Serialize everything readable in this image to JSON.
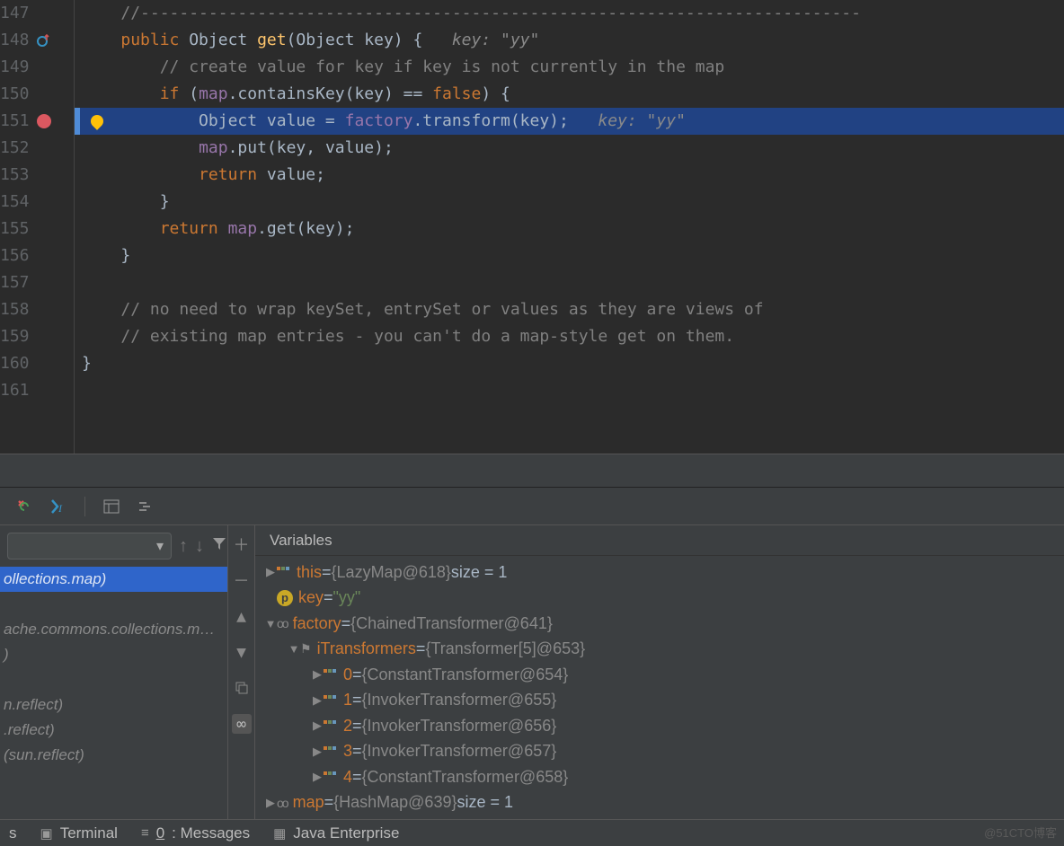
{
  "code": {
    "lines": [
      {
        "num": "147",
        "tokens": [
          {
            "c": "comment",
            "t": "//--------------------------------------------------------------------------"
          }
        ],
        "sep": true
      },
      {
        "num": "148",
        "tokens": [
          {
            "c": "kw",
            "t": "public "
          },
          {
            "c": "plain",
            "t": "Object "
          },
          {
            "c": "method-decl",
            "t": "get"
          },
          {
            "c": "plain",
            "t": "(Object key) {   "
          },
          {
            "c": "inlay",
            "t": "key: \"yy\""
          }
        ],
        "icon": "override"
      },
      {
        "num": "149",
        "tokens": [
          {
            "c": "comment",
            "t": "    // create value for key if key is not currently in the map"
          }
        ]
      },
      {
        "num": "150",
        "tokens": [
          {
            "c": "kw",
            "t": "    if "
          },
          {
            "c": "plain",
            "t": "("
          },
          {
            "c": "field",
            "t": "map"
          },
          {
            "c": "plain",
            "t": ".containsKey(key) == "
          },
          {
            "c": "kw",
            "t": "false"
          },
          {
            "c": "plain",
            "t": ") {"
          }
        ]
      },
      {
        "num": "151",
        "tokens": [
          {
            "c": "plain",
            "t": "        Object value = "
          },
          {
            "c": "field",
            "t": "factory"
          },
          {
            "c": "plain",
            "t": ".transform(key);   "
          },
          {
            "c": "inlay",
            "t": "key: \"yy\""
          }
        ],
        "hl": true,
        "bp": true,
        "bulb": true
      },
      {
        "num": "152",
        "tokens": [
          {
            "c": "plain",
            "t": "        "
          },
          {
            "c": "field",
            "t": "map"
          },
          {
            "c": "plain",
            "t": ".put(key, value);"
          }
        ]
      },
      {
        "num": "153",
        "tokens": [
          {
            "c": "kw",
            "t": "        return "
          },
          {
            "c": "plain",
            "t": "value;"
          }
        ]
      },
      {
        "num": "154",
        "tokens": [
          {
            "c": "plain",
            "t": "    }"
          }
        ]
      },
      {
        "num": "155",
        "tokens": [
          {
            "c": "kw",
            "t": "    return "
          },
          {
            "c": "field",
            "t": "map"
          },
          {
            "c": "plain",
            "t": ".get(key);"
          }
        ]
      },
      {
        "num": "156",
        "tokens": [
          {
            "c": "plain",
            "t": "}"
          }
        ]
      },
      {
        "num": "157",
        "tokens": [
          {
            "c": "plain",
            "t": ""
          }
        ]
      },
      {
        "num": "158",
        "tokens": [
          {
            "c": "comment",
            "t": "// no need to wrap keySet, entrySet or values as they are views of"
          }
        ]
      },
      {
        "num": "159",
        "tokens": [
          {
            "c": "comment",
            "t": "// existing map entries - you can't do a map-style get on them."
          }
        ]
      },
      {
        "num": "160",
        "tokens": [
          {
            "c": "plain",
            "t": "}"
          }
        ],
        "dedent": true
      },
      {
        "num": "161",
        "tokens": [
          {
            "c": "plain",
            "t": ""
          }
        ]
      }
    ],
    "base_indent": "    "
  },
  "frames": [
    {
      "text": "ollections.map)",
      "selected": true
    },
    {
      "text": ""
    },
    {
      "text": "ache.commons.collections.m…",
      "i": true
    },
    {
      "text": ")",
      "i": true
    },
    {
      "text": ""
    },
    {
      "text": "n.reflect)",
      "i": true
    },
    {
      "text": ".reflect)",
      "i": true
    },
    {
      "text": " (sun.reflect)",
      "i": true
    }
  ],
  "vars_title": "Variables",
  "vars": [
    {
      "indent": 0,
      "exp": "▶",
      "icon": "obj",
      "name": "this",
      "eq": " = ",
      "obj": "{LazyMap@618}",
      "size": "  size = 1"
    },
    {
      "indent": 0,
      "exp": "",
      "icon": "p",
      "name": "key",
      "eq": " = ",
      "str": "\"yy\""
    },
    {
      "indent": 0,
      "exp": "▼",
      "icon": "inf",
      "name": "factory",
      "eq": " = ",
      "obj": "{ChainedTransformer@641}"
    },
    {
      "indent": 1,
      "exp": "▼",
      "icon": "flag",
      "name": "iTransformers",
      "eq": " = ",
      "obj": "{Transformer[5]@653}"
    },
    {
      "indent": 2,
      "exp": "▶",
      "icon": "obj",
      "name": "0",
      "eq": " = ",
      "obj": "{ConstantTransformer@654}"
    },
    {
      "indent": 2,
      "exp": "▶",
      "icon": "obj",
      "name": "1",
      "eq": " = ",
      "obj": "{InvokerTransformer@655}"
    },
    {
      "indent": 2,
      "exp": "▶",
      "icon": "obj",
      "name": "2",
      "eq": " = ",
      "obj": "{InvokerTransformer@656}"
    },
    {
      "indent": 2,
      "exp": "▶",
      "icon": "obj",
      "name": "3",
      "eq": " = ",
      "obj": "{InvokerTransformer@657}"
    },
    {
      "indent": 2,
      "exp": "▶",
      "icon": "obj",
      "name": "4",
      "eq": " = ",
      "obj": "{ConstantTransformer@658}"
    },
    {
      "indent": 0,
      "exp": "▶",
      "icon": "inf",
      "name": "map",
      "eq": " = ",
      "obj": "{HashMap@639}",
      "size": "  size = 1"
    }
  ],
  "status": {
    "s0": "s",
    "terminal": "Terminal",
    "messages_key": "0",
    "messages": ": Messages",
    "enterprise": "Java Enterprise"
  },
  "watermark": "@51CTO博客"
}
